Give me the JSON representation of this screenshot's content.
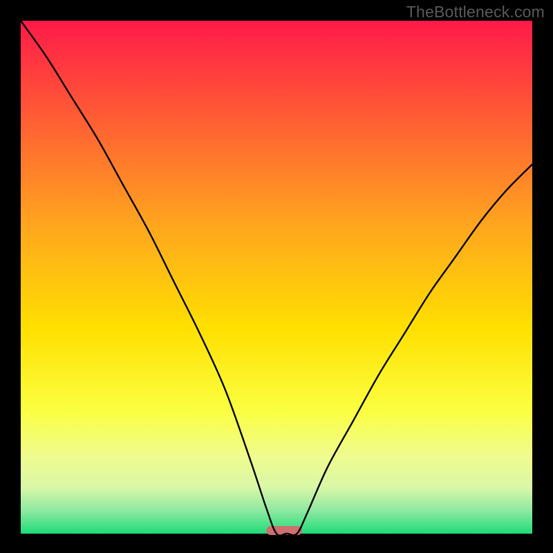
{
  "watermark": "TheBottleneck.com",
  "chart_data": {
    "type": "line",
    "title": "",
    "xlabel": "",
    "ylabel": "",
    "xlim": [
      0,
      100
    ],
    "ylim": [
      0,
      100
    ],
    "grid": false,
    "legend": false,
    "background_gradient": {
      "stops": [
        {
          "offset": 0.0,
          "color": "#ff1a49"
        },
        {
          "offset": 0.18,
          "color": "#ff5935"
        },
        {
          "offset": 0.4,
          "color": "#ffa61e"
        },
        {
          "offset": 0.6,
          "color": "#ffe000"
        },
        {
          "offset": 0.76,
          "color": "#fbff41"
        },
        {
          "offset": 0.85,
          "color": "#effc8f"
        },
        {
          "offset": 0.91,
          "color": "#d9f7a7"
        },
        {
          "offset": 0.955,
          "color": "#8ee9a1"
        },
        {
          "offset": 1.0,
          "color": "#1fdc79"
        }
      ]
    },
    "series": [
      {
        "name": "bottleneck-curve",
        "color": "#000000",
        "x": [
          0,
          5,
          10,
          15,
          20,
          25,
          30,
          35,
          40,
          45,
          48,
          50,
          52,
          54,
          56,
          60,
          65,
          70,
          75,
          80,
          85,
          90,
          95,
          100
        ],
        "y": [
          100,
          93,
          85,
          77,
          68,
          59,
          49,
          39,
          28,
          14,
          5,
          0,
          0,
          0,
          4,
          13,
          22,
          31,
          39,
          47,
          54,
          61,
          67,
          72
        ]
      }
    ],
    "marker": {
      "name": "optimum-pill",
      "x_center": 51.5,
      "width": 7.0,
      "color": "#cc6f6f"
    }
  }
}
